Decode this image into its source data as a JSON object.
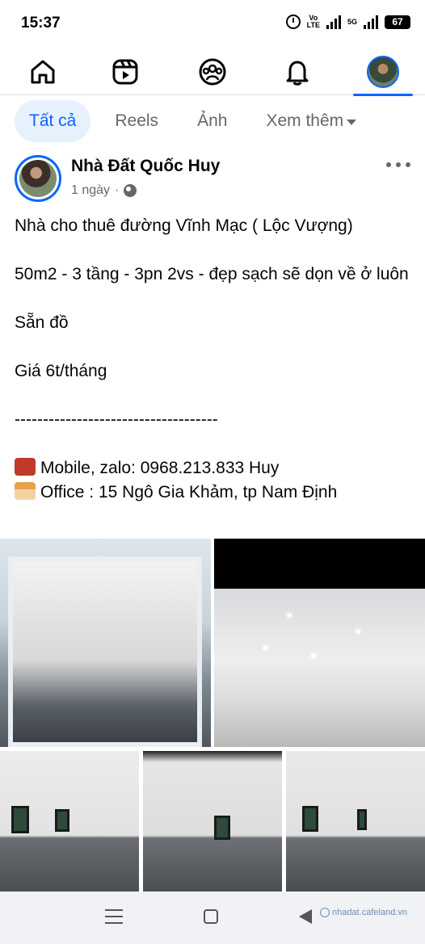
{
  "status_bar": {
    "time": "15:37",
    "volte_label": "Vo\nLTE",
    "network_label": "5G",
    "battery": "67"
  },
  "nav": {
    "items": [
      {
        "icon": "home-icon"
      },
      {
        "icon": "reels-icon"
      },
      {
        "icon": "groups-icon"
      },
      {
        "icon": "notifications-icon"
      },
      {
        "icon": "profile-avatar"
      }
    ],
    "active_index": 4,
    "accent_color": "#0866ff"
  },
  "filters": {
    "items": [
      "Tất cả",
      "Reels",
      "Ảnh",
      "Xem thêm"
    ],
    "active": "Tất cả"
  },
  "post": {
    "author": "Nhà Đất Quốc Huy",
    "time": "1 ngày",
    "separator": "·",
    "privacy_icon": "globe-icon",
    "lines": {
      "l1": "Nhà cho thuê đường Vĩnh Mạc ( Lộc Vượng)",
      "l2": "50m2 - 3 tầng - 3pn 2vs - đẹp sạch sẽ dọn về ở luôn",
      "l3": "Sẵn đồ",
      "l4": "Giá 6t/tháng",
      "l5": "------------------------------------",
      "l6": "Mobile, zalo: 0968.213.833 Huy",
      "l7": "Office : 15 Ngô Gia Khảm, tp Nam Định"
    },
    "photo_count": 5
  },
  "system_nav": {
    "watermark": "nhadat.cafeland.vn"
  }
}
